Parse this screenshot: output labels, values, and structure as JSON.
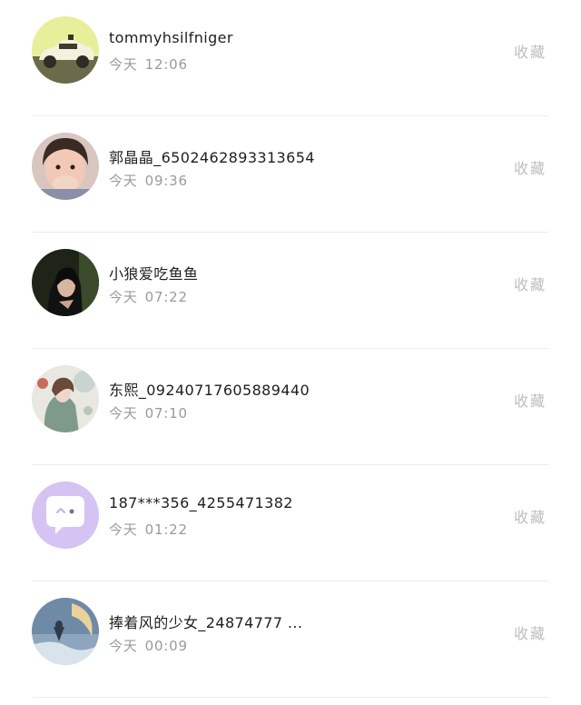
{
  "items": [
    {
      "name": "tommyhsilfniger",
      "day": "今天",
      "time": "12:06",
      "action": "收藏",
      "avatar": "toy-car-avatar"
    },
    {
      "name": "郭晶晶_6502462893313654",
      "day": "今天",
      "time": "09:36",
      "action": "收藏",
      "avatar": "child-face-avatar"
    },
    {
      "name": "小狼爱吃鱼鱼",
      "day": "今天",
      "time": "07:22",
      "action": "收藏",
      "avatar": "dark-portrait-avatar"
    },
    {
      "name": "东熙_09240717605889440",
      "day": "今天",
      "time": "07:10",
      "action": "收藏",
      "avatar": "illustration-avatar"
    },
    {
      "name": "187***356_4255471382",
      "day": "今天",
      "time": "01:22",
      "action": "收藏",
      "avatar": "chat-bubble-avatar"
    },
    {
      "name": "捧着风的少女_24874777 ...",
      "day": "今天",
      "time": "00:09",
      "action": "收藏",
      "avatar": "moon-scene-avatar"
    }
  ]
}
